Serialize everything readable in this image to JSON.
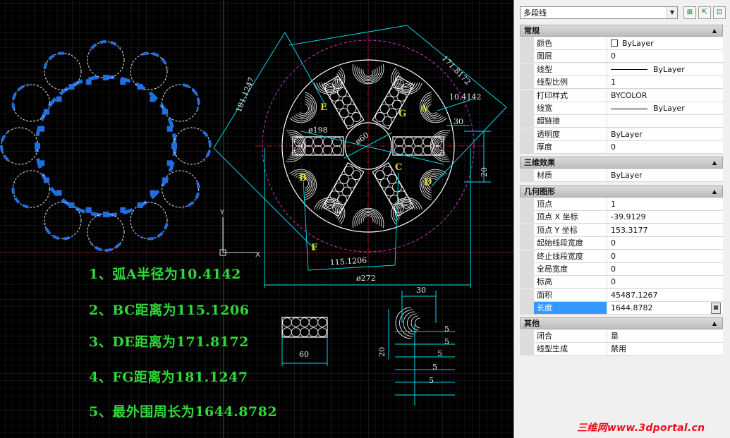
{
  "drawing": {
    "notes": [
      "1、弧A半径为10.4142",
      "2、BC距离为115.1206",
      "3、DE距离为171.8172",
      "4、FG距离为181.1247",
      "5、最外围周长为1644.8782"
    ],
    "labels": {
      "A": "A",
      "B": "B",
      "C": "C",
      "D": "D",
      "E": "E",
      "F": "F",
      "G": "G"
    },
    "dimensions": {
      "d171": "171.8172",
      "d181": "181.1247",
      "d10": "10.4142",
      "d30": "30",
      "d20": "20",
      "dia198": "ø198",
      "dia60": "ø60",
      "d115": "115.1206",
      "dia272": "ø272",
      "d30b": "30",
      "d60": "60",
      "d20b": "20",
      "d5": "5"
    },
    "ucs": {
      "x": "X",
      "y": "Y"
    },
    "colors": {
      "green_text": "#2fd93a",
      "dim_cyan": "#00d8e8",
      "selection_blue": "#1f6fe0",
      "circle_magenta": "#cc2fcc",
      "axis_red": "#c8101a"
    }
  },
  "palette": {
    "object_type": "多段线",
    "buttons": [
      "quick-select-icon",
      "select-objects-icon",
      "toggle-pickadd-icon"
    ],
    "sections": {
      "general": {
        "title": "常规",
        "rows": [
          {
            "name": "颜色",
            "value": "ByLayer"
          },
          {
            "name": "图层",
            "value": "0"
          },
          {
            "name": "线型",
            "value": "ByLayer"
          },
          {
            "name": "线型比例",
            "value": "1"
          },
          {
            "name": "打印样式",
            "value": "BYCOLOR"
          },
          {
            "name": "线宽",
            "value": "ByLayer"
          },
          {
            "name": "超链接",
            "value": ""
          },
          {
            "name": "透明度",
            "value": "ByLayer"
          },
          {
            "name": "厚度",
            "value": "0"
          }
        ]
      },
      "threed": {
        "title": "三维效果",
        "rows": [
          {
            "name": "材质",
            "value": "ByLayer"
          }
        ]
      },
      "geometry": {
        "title": "几何图形",
        "rows": [
          {
            "name": "顶点",
            "value": "1"
          },
          {
            "name": "顶点 X 坐标",
            "value": "-39.9129"
          },
          {
            "name": "顶点 Y 坐标",
            "value": "153.3177"
          },
          {
            "name": "起始线段宽度",
            "value": "0"
          },
          {
            "name": "终止线段宽度",
            "value": "0"
          },
          {
            "name": "全局宽度",
            "value": "0"
          },
          {
            "name": "标高",
            "value": "0"
          },
          {
            "name": "面积",
            "value": "45487.1267"
          },
          {
            "name": "长度",
            "value": "1644.8782"
          }
        ]
      },
      "misc": {
        "title": "其他",
        "rows": [
          {
            "name": "闭合",
            "value": "是"
          },
          {
            "name": "线型生成",
            "value": "禁用"
          }
        ]
      }
    }
  },
  "watermark": "三维网www.3dportal.cn"
}
